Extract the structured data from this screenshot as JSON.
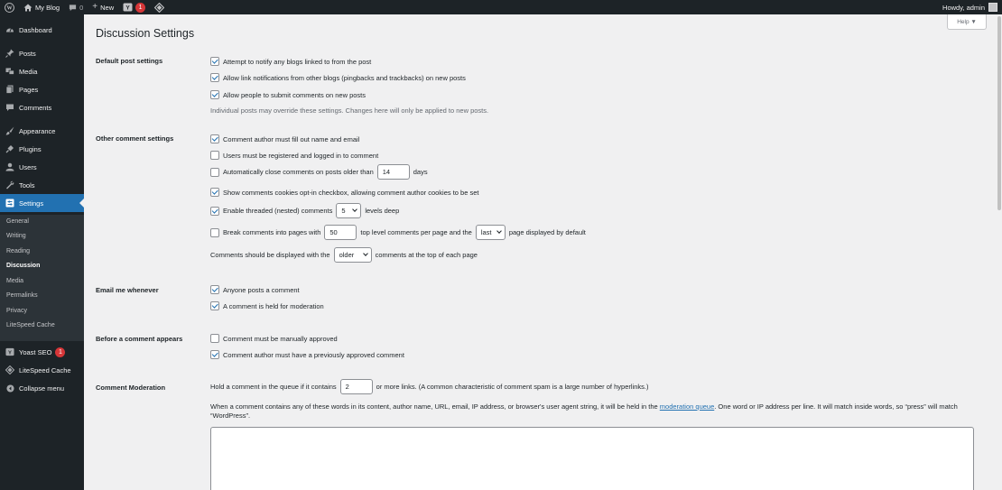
{
  "adminbar": {
    "site_name": "My Blog",
    "comments_count": "0",
    "new_label": "New",
    "yoast_badge": "1",
    "howdy": "Howdy, admin"
  },
  "sidebar": {
    "items": [
      {
        "label": "Dashboard",
        "icon": "dashboard-icon"
      },
      {
        "label": "Posts",
        "icon": "pin-icon"
      },
      {
        "label": "Media",
        "icon": "media-icon"
      },
      {
        "label": "Pages",
        "icon": "pages-icon"
      },
      {
        "label": "Comments",
        "icon": "comment-icon"
      },
      {
        "label": "Appearance",
        "icon": "brush-icon"
      },
      {
        "label": "Plugins",
        "icon": "plug-icon"
      },
      {
        "label": "Users",
        "icon": "user-icon"
      },
      {
        "label": "Tools",
        "icon": "wrench-icon"
      },
      {
        "label": "Settings",
        "icon": "settings-icon"
      }
    ],
    "submenu": [
      "General",
      "Writing",
      "Reading",
      "Discussion",
      "Media",
      "Permalinks",
      "Privacy",
      "LiteSpeed Cache"
    ],
    "bottom": [
      {
        "label": "Yoast SEO",
        "badge": "1",
        "icon": "yoast-icon"
      },
      {
        "label": "LiteSpeed Cache",
        "icon": "litespeed-icon"
      },
      {
        "label": "Collapse menu",
        "icon": "collapse-icon"
      }
    ]
  },
  "page": {
    "title": "Discussion Settings",
    "help": "Help ▼"
  },
  "sections": {
    "default_post": {
      "label": "Default post settings",
      "opt1": "Attempt to notify any blogs linked to from the post",
      "opt2": "Allow link notifications from other blogs (pingbacks and trackbacks) on new posts",
      "opt3": "Allow people to submit comments on new posts",
      "desc": "Individual posts may override these settings. Changes here will only be applied to new posts."
    },
    "other_comment": {
      "label": "Other comment settings",
      "opt1": "Comment author must fill out name and email",
      "opt2": "Users must be registered and logged in to comment",
      "opt3_before": "Automatically close comments on posts older than",
      "close_days_value": "14",
      "opt3_after": "days",
      "opt4": "Show comments cookies opt-in checkbox, allowing comment author cookies to be set",
      "opt5_before": "Enable threaded (nested) comments",
      "thread_depth_value": "5",
      "opt5_after": "levels deep",
      "opt6_before": "Break comments into pages with",
      "per_page_value": "50",
      "opt6_mid": "top level comments per page and the",
      "page_order_value": "last",
      "opt6_after": "page displayed by default",
      "display_before": "Comments should be displayed with the",
      "display_order_value": "older",
      "display_after": "comments at the top of each page"
    },
    "email": {
      "label": "Email me whenever",
      "opt1": "Anyone posts a comment",
      "opt2": "A comment is held for moderation"
    },
    "before_appears": {
      "label": "Before a comment appears",
      "opt1": "Comment must be manually approved",
      "opt2": "Comment author must have a previously approved comment"
    },
    "moderation": {
      "label": "Comment Moderation",
      "hold_before": "Hold a comment in the queue if it contains",
      "links_value": "2",
      "hold_after": "or more links. (A common characteristic of comment spam is a large number of hyperlinks.)",
      "para_before": "When a comment contains any of these words in its content, author name, URL, email, IP address, or browser's user agent string, it will be held in the",
      "para_link": "moderation queue",
      "para_after": ". One word or IP address per line. It will match inside words, so “press” will match “WordPress”."
    }
  },
  "colors": {
    "accent": "#2271b1",
    "adminbar": "#1d2327",
    "badge": "#d63638"
  }
}
